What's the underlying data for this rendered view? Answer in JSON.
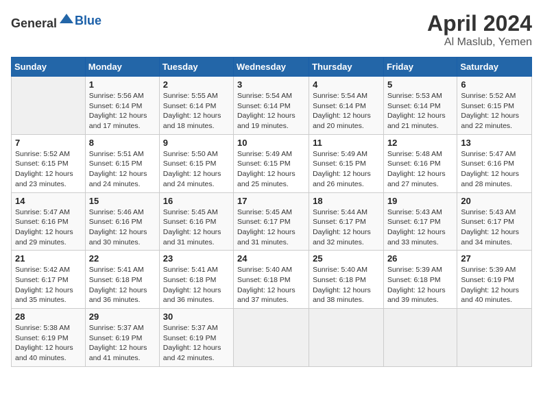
{
  "header": {
    "logo_general": "General",
    "logo_blue": "Blue",
    "month": "April 2024",
    "location": "Al Maslub, Yemen"
  },
  "weekdays": [
    "Sunday",
    "Monday",
    "Tuesday",
    "Wednesday",
    "Thursday",
    "Friday",
    "Saturday"
  ],
  "weeks": [
    [
      {
        "day": "",
        "info": ""
      },
      {
        "day": "1",
        "info": "Sunrise: 5:56 AM\nSunset: 6:14 PM\nDaylight: 12 hours\nand 17 minutes."
      },
      {
        "day": "2",
        "info": "Sunrise: 5:55 AM\nSunset: 6:14 PM\nDaylight: 12 hours\nand 18 minutes."
      },
      {
        "day": "3",
        "info": "Sunrise: 5:54 AM\nSunset: 6:14 PM\nDaylight: 12 hours\nand 19 minutes."
      },
      {
        "day": "4",
        "info": "Sunrise: 5:54 AM\nSunset: 6:14 PM\nDaylight: 12 hours\nand 20 minutes."
      },
      {
        "day": "5",
        "info": "Sunrise: 5:53 AM\nSunset: 6:14 PM\nDaylight: 12 hours\nand 21 minutes."
      },
      {
        "day": "6",
        "info": "Sunrise: 5:52 AM\nSunset: 6:15 PM\nDaylight: 12 hours\nand 22 minutes."
      }
    ],
    [
      {
        "day": "7",
        "info": "Sunrise: 5:52 AM\nSunset: 6:15 PM\nDaylight: 12 hours\nand 23 minutes."
      },
      {
        "day": "8",
        "info": "Sunrise: 5:51 AM\nSunset: 6:15 PM\nDaylight: 12 hours\nand 24 minutes."
      },
      {
        "day": "9",
        "info": "Sunrise: 5:50 AM\nSunset: 6:15 PM\nDaylight: 12 hours\nand 24 minutes."
      },
      {
        "day": "10",
        "info": "Sunrise: 5:49 AM\nSunset: 6:15 PM\nDaylight: 12 hours\nand 25 minutes."
      },
      {
        "day": "11",
        "info": "Sunrise: 5:49 AM\nSunset: 6:15 PM\nDaylight: 12 hours\nand 26 minutes."
      },
      {
        "day": "12",
        "info": "Sunrise: 5:48 AM\nSunset: 6:16 PM\nDaylight: 12 hours\nand 27 minutes."
      },
      {
        "day": "13",
        "info": "Sunrise: 5:47 AM\nSunset: 6:16 PM\nDaylight: 12 hours\nand 28 minutes."
      }
    ],
    [
      {
        "day": "14",
        "info": "Sunrise: 5:47 AM\nSunset: 6:16 PM\nDaylight: 12 hours\nand 29 minutes."
      },
      {
        "day": "15",
        "info": "Sunrise: 5:46 AM\nSunset: 6:16 PM\nDaylight: 12 hours\nand 30 minutes."
      },
      {
        "day": "16",
        "info": "Sunrise: 5:45 AM\nSunset: 6:16 PM\nDaylight: 12 hours\nand 31 minutes."
      },
      {
        "day": "17",
        "info": "Sunrise: 5:45 AM\nSunset: 6:17 PM\nDaylight: 12 hours\nand 31 minutes."
      },
      {
        "day": "18",
        "info": "Sunrise: 5:44 AM\nSunset: 6:17 PM\nDaylight: 12 hours\nand 32 minutes."
      },
      {
        "day": "19",
        "info": "Sunrise: 5:43 AM\nSunset: 6:17 PM\nDaylight: 12 hours\nand 33 minutes."
      },
      {
        "day": "20",
        "info": "Sunrise: 5:43 AM\nSunset: 6:17 PM\nDaylight: 12 hours\nand 34 minutes."
      }
    ],
    [
      {
        "day": "21",
        "info": "Sunrise: 5:42 AM\nSunset: 6:17 PM\nDaylight: 12 hours\nand 35 minutes."
      },
      {
        "day": "22",
        "info": "Sunrise: 5:41 AM\nSunset: 6:18 PM\nDaylight: 12 hours\nand 36 minutes."
      },
      {
        "day": "23",
        "info": "Sunrise: 5:41 AM\nSunset: 6:18 PM\nDaylight: 12 hours\nand 36 minutes."
      },
      {
        "day": "24",
        "info": "Sunrise: 5:40 AM\nSunset: 6:18 PM\nDaylight: 12 hours\nand 37 minutes."
      },
      {
        "day": "25",
        "info": "Sunrise: 5:40 AM\nSunset: 6:18 PM\nDaylight: 12 hours\nand 38 minutes."
      },
      {
        "day": "26",
        "info": "Sunrise: 5:39 AM\nSunset: 6:18 PM\nDaylight: 12 hours\nand 39 minutes."
      },
      {
        "day": "27",
        "info": "Sunrise: 5:39 AM\nSunset: 6:19 PM\nDaylight: 12 hours\nand 40 minutes."
      }
    ],
    [
      {
        "day": "28",
        "info": "Sunrise: 5:38 AM\nSunset: 6:19 PM\nDaylight: 12 hours\nand 40 minutes."
      },
      {
        "day": "29",
        "info": "Sunrise: 5:37 AM\nSunset: 6:19 PM\nDaylight: 12 hours\nand 41 minutes."
      },
      {
        "day": "30",
        "info": "Sunrise: 5:37 AM\nSunset: 6:19 PM\nDaylight: 12 hours\nand 42 minutes."
      },
      {
        "day": "",
        "info": ""
      },
      {
        "day": "",
        "info": ""
      },
      {
        "day": "",
        "info": ""
      },
      {
        "day": "",
        "info": ""
      }
    ]
  ]
}
